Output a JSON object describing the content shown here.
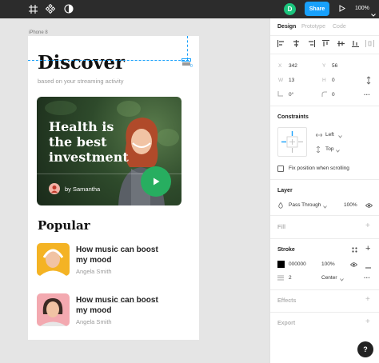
{
  "toolbar": {
    "avatar_initial": "D",
    "share_label": "Share",
    "zoom": "100%"
  },
  "canvas": {
    "frame_name": "iPhone 8",
    "selection_number": "0",
    "app": {
      "title": "Discover",
      "subtitle": "based on your streaming activity",
      "hero": {
        "title": "Health is\nthe best\ninvestment",
        "author": "by Samantha"
      },
      "popular_heading": "Popular",
      "popular_items": [
        {
          "title": "How music can boost\nmy mood",
          "author": "Angela Smith"
        },
        {
          "title": "How music can boost\nmy mood",
          "author": "Angela Smith"
        }
      ]
    }
  },
  "panel": {
    "tabs": [
      "Design",
      "Prototype",
      "Code"
    ],
    "x_label": "X",
    "x_value": "342",
    "y_label": "Y",
    "y_value": "56",
    "w_label": "W",
    "w_value": "13",
    "h_label": "H",
    "h_value": "0",
    "rotation_value": "0°",
    "radius_value": "0",
    "constraints_heading": "Constraints",
    "constraint_h": "Left",
    "constraint_v": "Top",
    "fix_position_label": "Fix position when scrolling",
    "layer_heading": "Layer",
    "blend_mode": "Pass Through",
    "layer_opacity": "100%",
    "fill_heading": "Fill",
    "stroke_heading": "Stroke",
    "stroke_color": "000000",
    "stroke_opacity": "100%",
    "stroke_weight": "2",
    "stroke_align": "Center",
    "effects_heading": "Effects",
    "export_heading": "Export",
    "help_label": "?"
  },
  "colors": {
    "toolbar_bg": "#2c2c2c",
    "share_blue": "#18a0fb",
    "avatar_green": "#1bc47d",
    "play_green": "#27ae60"
  }
}
